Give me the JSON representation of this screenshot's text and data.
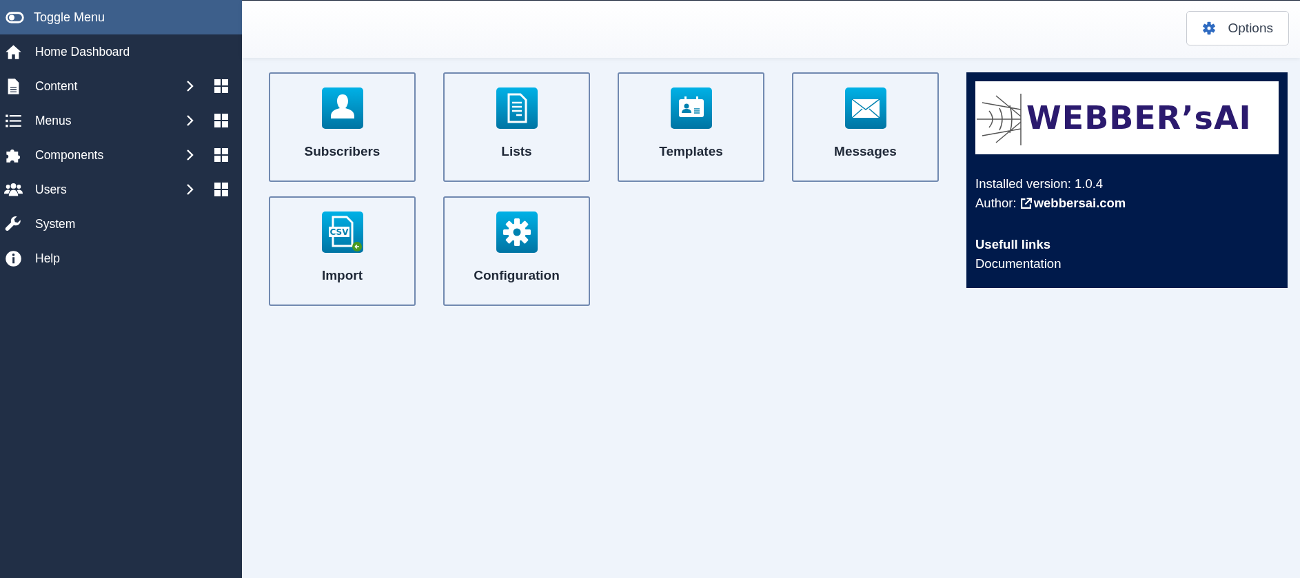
{
  "sidebar": {
    "toggle": {
      "label": "Toggle Menu"
    },
    "items": [
      {
        "label": "Home Dashboard",
        "kind": "home",
        "has_submenu": false
      },
      {
        "label": "Content",
        "kind": "file",
        "has_submenu": true
      },
      {
        "label": "Menus",
        "kind": "list",
        "has_submenu": true
      },
      {
        "label": "Components",
        "kind": "puzzle",
        "has_submenu": true
      },
      {
        "label": "Users",
        "kind": "users",
        "has_submenu": true
      },
      {
        "label": "System",
        "kind": "wrench",
        "has_submenu": false
      },
      {
        "label": "Help",
        "kind": "info",
        "has_submenu": false
      }
    ]
  },
  "toolbar": {
    "options_button": "Options"
  },
  "tiles": [
    {
      "label": "Subscribers",
      "kind": "user"
    },
    {
      "label": "Lists",
      "kind": "document"
    },
    {
      "label": "Templates",
      "kind": "badge"
    },
    {
      "label": "Messages",
      "kind": "envelope"
    },
    {
      "label": "Import",
      "kind": "csv",
      "icon_text": "CSV"
    },
    {
      "label": "Configuration",
      "kind": "gear"
    }
  ],
  "info_panel": {
    "logo_text": "WEBBER’sAI",
    "version": "Installed version: 1.0.4",
    "author_label": "Author:",
    "author_link": "webbersai.com",
    "links_heading": "Usefull links",
    "links": [
      "Documentation"
    ]
  }
}
